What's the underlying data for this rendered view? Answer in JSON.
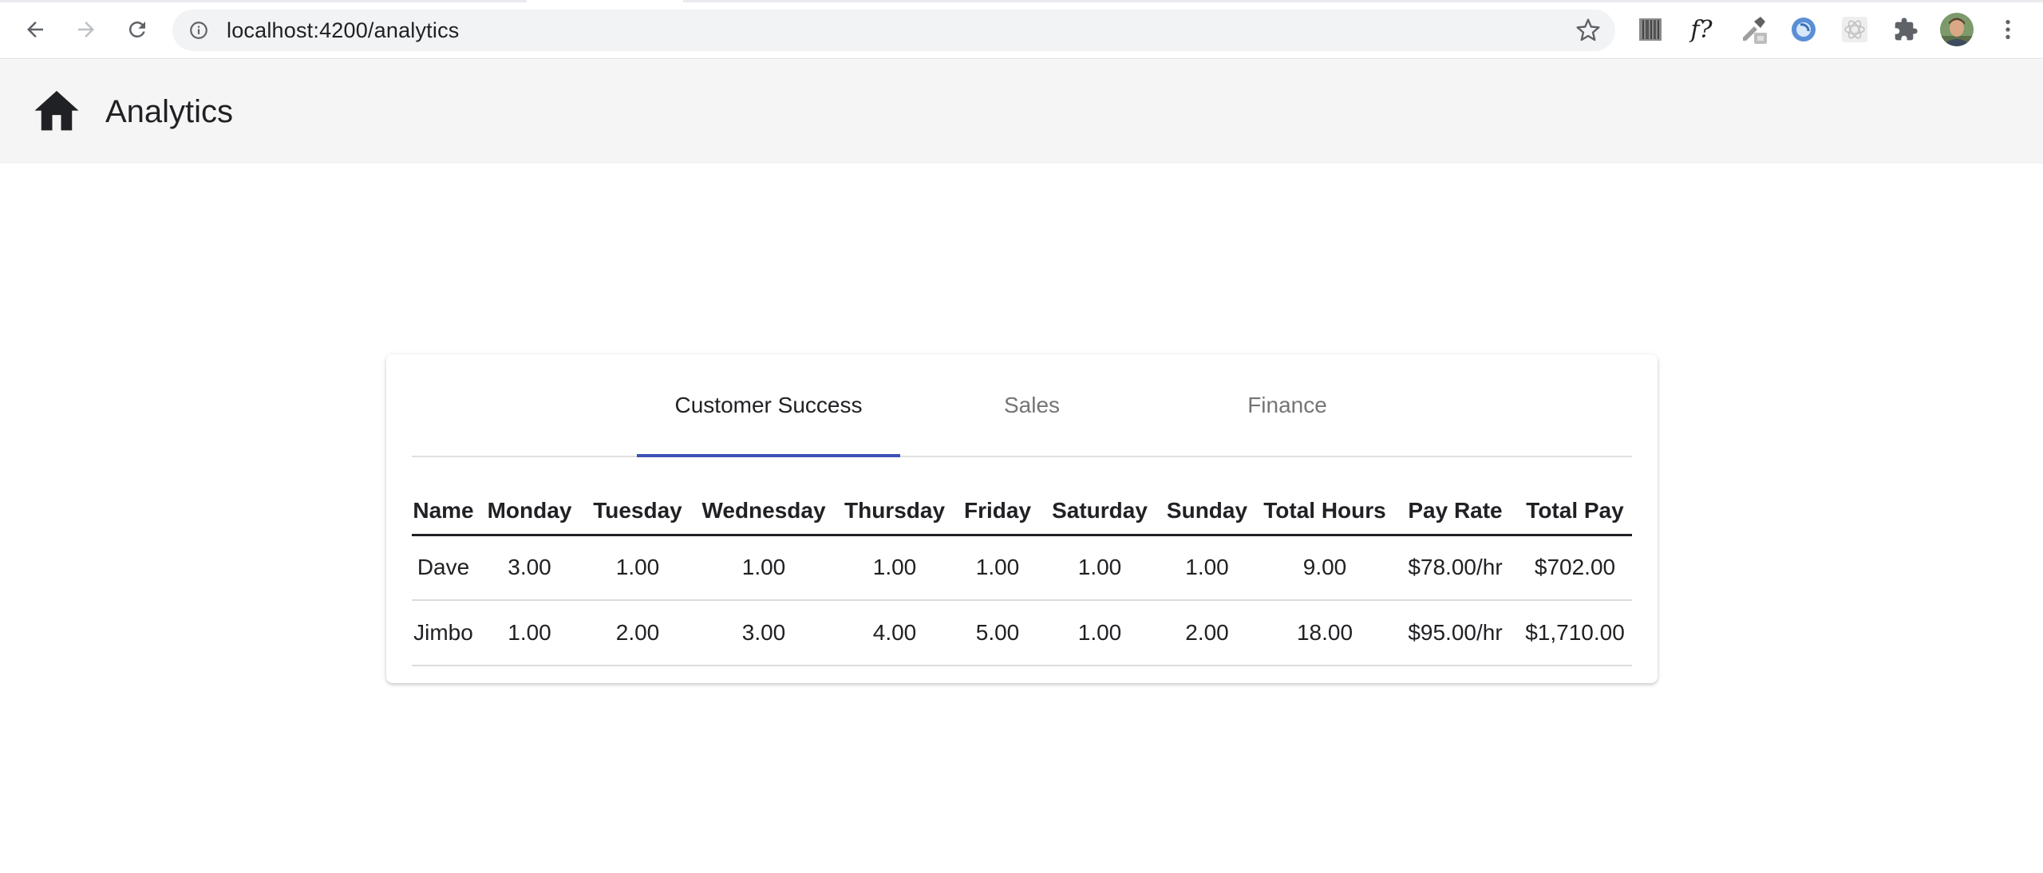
{
  "browser": {
    "url": "localhost:4200/analytics",
    "extensions": [
      "barcode-extension-icon",
      "formula-extension-icon",
      "eyedropper-extension-icon",
      "blue-circle-extension-icon",
      "react-devtools-icon",
      "puzzle-icon",
      "profile-avatar",
      "kebab-menu-icon"
    ]
  },
  "app": {
    "title": "Analytics"
  },
  "tabs": [
    {
      "label": "Customer Success",
      "active": true
    },
    {
      "label": "Sales",
      "active": false
    },
    {
      "label": "Finance",
      "active": false
    }
  ],
  "table": {
    "columns": [
      "Name",
      "Monday",
      "Tuesday",
      "Wednesday",
      "Thursday",
      "Friday",
      "Saturday",
      "Sunday",
      "Total Hours",
      "Pay Rate",
      "Total Pay"
    ],
    "rows": [
      [
        "Dave",
        "3.00",
        "1.00",
        "1.00",
        "1.00",
        "1.00",
        "1.00",
        "1.00",
        "9.00",
        "$78.00/hr",
        "$702.00"
      ],
      [
        "Jimbo",
        "1.00",
        "2.00",
        "3.00",
        "4.00",
        "5.00",
        "1.00",
        "2.00",
        "18.00",
        "$95.00/hr",
        "$1,710.00"
      ]
    ]
  },
  "colors": {
    "tab_ink": "#3f51b5",
    "toolbar_bg": "#f5f5f5"
  }
}
